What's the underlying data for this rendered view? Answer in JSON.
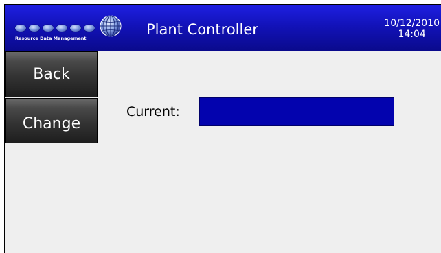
{
  "header": {
    "logo_text": "Resource Data Management",
    "title": "Plant Controller",
    "date": "10/12/2010",
    "time": "14:04"
  },
  "nav": {
    "back_label": "Back",
    "change_label": "Change"
  },
  "main": {
    "current_label": "Current:",
    "current_value": ""
  },
  "colors": {
    "header_bg": "#1212b8",
    "field_bg": "#0303ae",
    "button_bg": "#333333",
    "panel_bg": "#efefef"
  },
  "icons": [
    "globe-icon"
  ]
}
